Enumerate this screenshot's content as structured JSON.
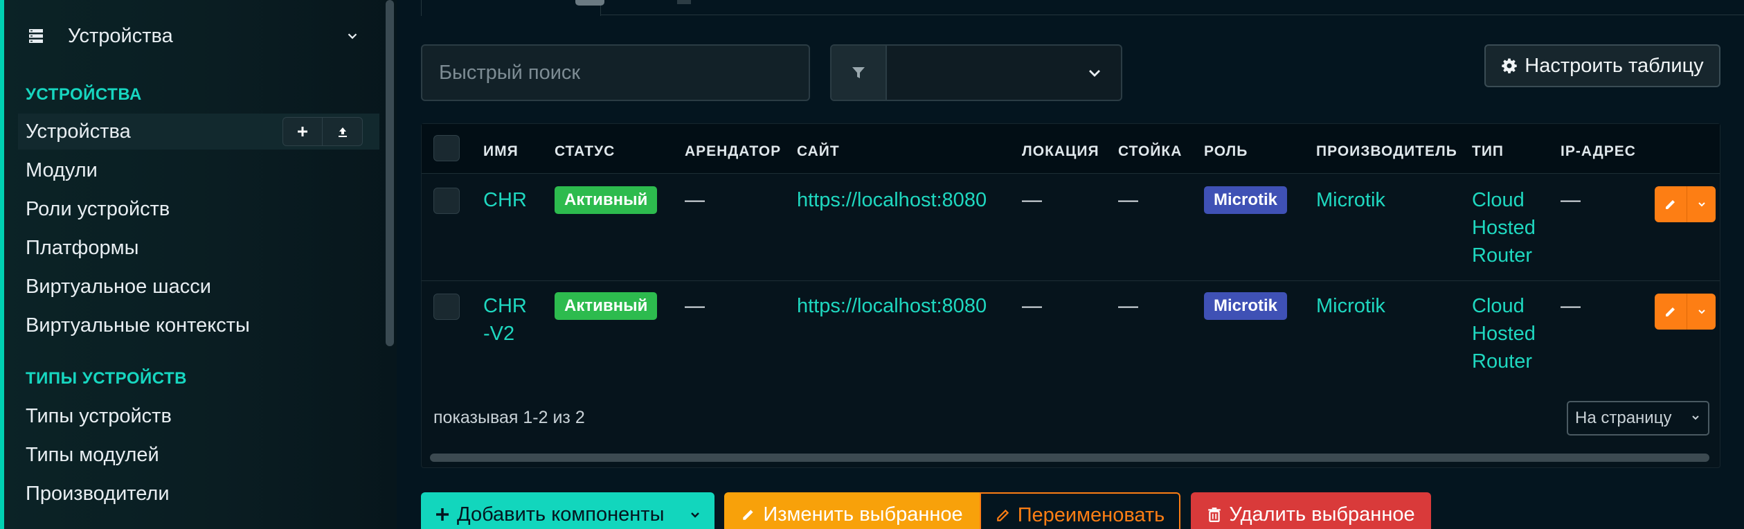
{
  "sidebar": {
    "header_label": "Устройства",
    "sections": [
      {
        "title": "УСТРОЙСТВА",
        "items": [
          {
            "label": "Устройства"
          },
          {
            "label": "Модули"
          },
          {
            "label": "Роли устройств"
          },
          {
            "label": "Платформы"
          },
          {
            "label": "Виртуальное шасси"
          },
          {
            "label": "Виртуальные контексты"
          }
        ]
      },
      {
        "title": "ТИПЫ УСТРОЙСТВ",
        "items": [
          {
            "label": "Типы устройств"
          },
          {
            "label": "Типы модулей"
          },
          {
            "label": "Производители"
          }
        ]
      }
    ]
  },
  "toolbar": {
    "search_placeholder": "Быстрый поиск",
    "configure_label": "Настроить таблицу"
  },
  "table": {
    "columns": [
      "ИМЯ",
      "СТАТУС",
      "АРЕНДАТОР",
      "САЙТ",
      "ЛОКАЦИЯ",
      "СТОЙКА",
      "РОЛЬ",
      "ПРОИЗВОДИТЕЛЬ",
      "ТИП",
      "IP-АДРЕС"
    ],
    "rows": [
      {
        "name_line1": "CHR",
        "name_line2": "",
        "status": "Активный",
        "tenant": "—",
        "site": "https://localhost:8080",
        "location": "—",
        "rack": "—",
        "role": "Microtik",
        "manufacturer": "Microtik",
        "type_line1": "Cloud",
        "type_line2": "Hosted",
        "type_line3": "Router",
        "ip": "—"
      },
      {
        "name_line1": "CHR",
        "name_line2": "-V2",
        "status": "Активный",
        "tenant": "—",
        "site": "https://localhost:8080",
        "location": "—",
        "rack": "—",
        "role": "Microtik",
        "manufacturer": "Microtik",
        "type_line1": "Cloud",
        "type_line2": "Hosted",
        "type_line3": "Router",
        "ip": "—"
      }
    ],
    "showing": "показывая 1-2 из 2",
    "per_page": "На страницу"
  },
  "actions": {
    "add": "Добавить компоненты",
    "edit": "Изменить выбранное",
    "rename": "Переименовать",
    "delete": "Удалить выбранное"
  },
  "colors": {
    "accent": "#17d6c0",
    "status_active": "#2dbb4e",
    "role_badge": "#3f51b5",
    "edit_orange": "#fd7e14",
    "edit_yellow": "#f8a10a",
    "delete_red": "#d93a3a"
  },
  "icons": {
    "sidebar_header": "server-icon",
    "filter": "filter-icon",
    "configure": "gear-icon",
    "add": "plus-icon",
    "import": "upload-icon",
    "edit": "pencil-icon",
    "delete": "trash-icon"
  }
}
